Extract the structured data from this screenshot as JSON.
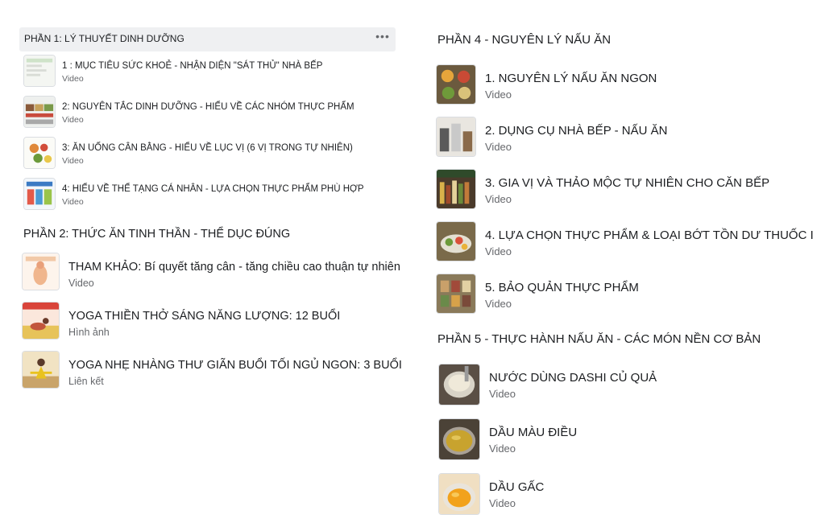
{
  "sections": [
    {
      "title": "PHẦN 1: LÝ THUYẾT DINH DƯỠNG",
      "more_icon": "more-horizontal-icon",
      "items": [
        {
          "title": "1 : MỤC TIÊU SỨC KHOẺ - NHẬN DIỆN \"SÁT THỦ\" NHÀ BẾP",
          "type": "Video"
        },
        {
          "title": "2: NGUYÊN TẮC DINH DƯỠNG - HIỂU VỀ CÁC NHÓM THỰC PHẨM",
          "type": "Video"
        },
        {
          "title": "3: ĂN UỐNG CÂN BẰNG - HIỂU VỀ LỤC VỊ (6 VỊ TRONG TỰ NHIÊN)",
          "type": "Video"
        },
        {
          "title": "4: HIỂU VỀ THỂ TẠNG CÁ NHÂN - LỰA CHỌN THỰC PHẨM PHÙ HỢP",
          "type": "Video"
        }
      ]
    },
    {
      "title": "PHẦN 2: THỨC ĂN TINH THẦN - THỂ DỤC ĐÚNG",
      "items": [
        {
          "title": "THAM KHẢO: Bí quyết tăng cân - tăng chiều cao thuận tự nhiên",
          "type": "Video"
        },
        {
          "title": "YOGA THIỀN THỞ SÁNG NĂNG LƯỢNG: 12 BUỔI",
          "type": "Hình ảnh"
        },
        {
          "title": "YOGA NHẸ NHÀNG THƯ GIÃN BUỔI TỐI NGỦ NGON: 3 BUỔI",
          "type": "Liên kết"
        }
      ]
    },
    {
      "title": "PHẦN 4 - NGUYÊN LÝ NẤU ĂN",
      "items": [
        {
          "title": "1. NGUYÊN LÝ NẤU ĂN NGON",
          "type": "Video"
        },
        {
          "title": "2. DỤNG CỤ NHÀ BẾP - NẤU ĂN",
          "type": "Video"
        },
        {
          "title": "3. GIA VỊ VÀ THẢO MỘC TỰ NHIÊN CHO CĂN BẾP",
          "type": "Video"
        },
        {
          "title": "4. LỰA CHỌN THỰC PHẨM & LOẠI BỚT TỒN DƯ THUỐC I",
          "type": "Video"
        },
        {
          "title": "5. BẢO QUẢN THỰC PHẨM",
          "type": "Video"
        }
      ]
    },
    {
      "title": "PHẦN 5 - THỰC HÀNH NẤU ĂN - CÁC MÓN NỀN CƠ BẢN",
      "items": [
        {
          "title": "NƯỚC DÙNG DASHI CỦ QUẢ",
          "type": "Video"
        },
        {
          "title": "DẦU MÀU ĐIỀU",
          "type": "Video"
        },
        {
          "title": "DẦU GẤC",
          "type": "Video"
        }
      ]
    }
  ]
}
